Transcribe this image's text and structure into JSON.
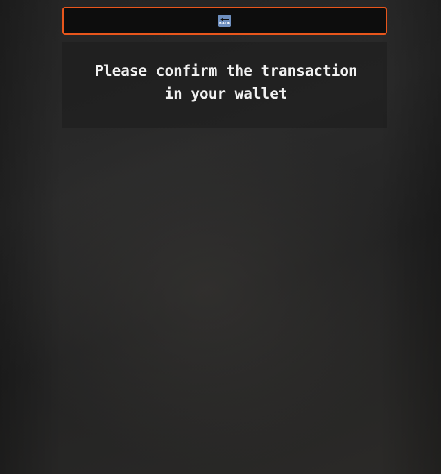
{
  "back_button": {
    "icon": "back-arrow-icon",
    "icon_text": "BACK",
    "border_color": "#e8561c",
    "icon_color": "#6e8fbf"
  },
  "message": {
    "text": "Please confirm the transaction\nin your wallet"
  }
}
